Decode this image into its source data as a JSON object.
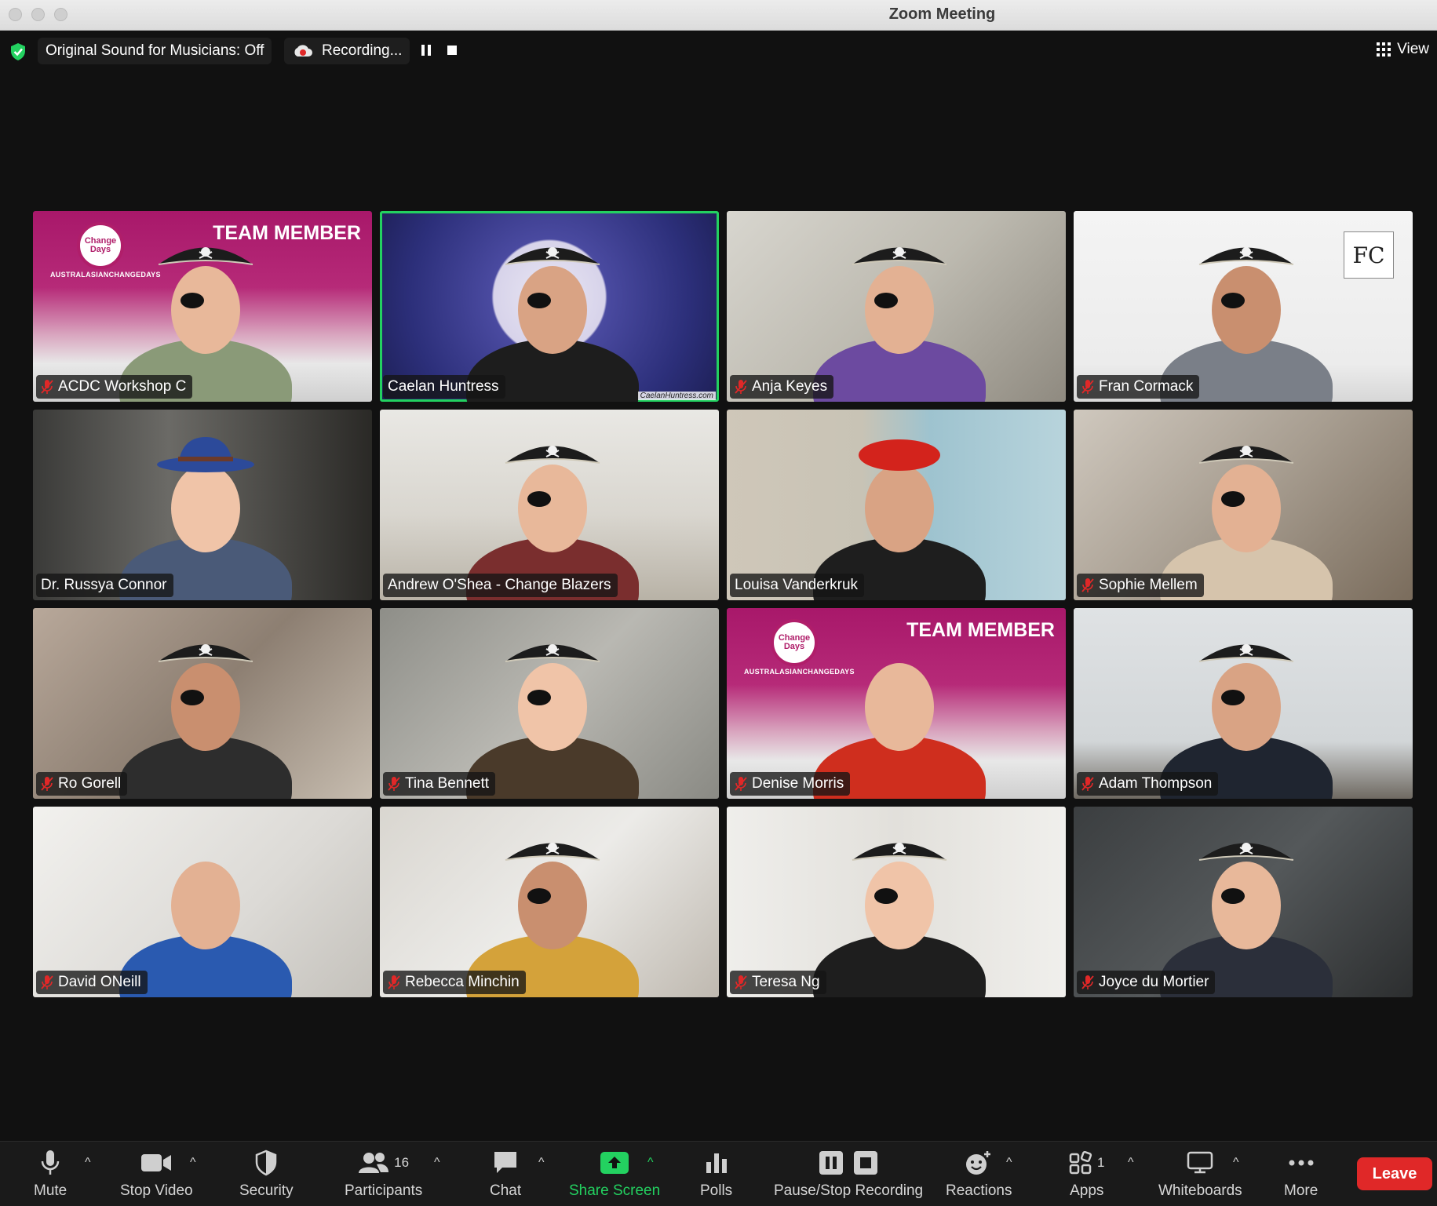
{
  "window": {
    "title": "Zoom Meeting"
  },
  "topbar": {
    "original_sound": "Original Sound for Musicians: Off",
    "recording": "Recording...",
    "view": "View"
  },
  "participants": [
    {
      "name": "ACDC Workshop C",
      "muted": true,
      "bg": "banner",
      "hat": "pirate"
    },
    {
      "name": "Caelan Huntress",
      "muted": false,
      "bg": "moon",
      "hat": "pirate",
      "active": true,
      "watermark": "CaelanHuntress.com"
    },
    {
      "name": "Anja Keyes",
      "muted": true,
      "bg": "room-light",
      "hat": "pirate"
    },
    {
      "name": "Fran Cormack",
      "muted": true,
      "bg": "white",
      "hat": "pirate",
      "logo": "FC"
    },
    {
      "name": "Dr. Russya Connor",
      "muted": false,
      "bg": "dark-room",
      "hat": "fedora"
    },
    {
      "name": "Andrew O'Shea - Change Blazers",
      "muted": false,
      "bg": "living-room",
      "hat": "pirate"
    },
    {
      "name": "Louisa Vanderkruk",
      "muted": false,
      "bg": "art-wall",
      "hat": "beret"
    },
    {
      "name": "Sophie Mellem",
      "muted": true,
      "bg": "home",
      "hat": "pirate"
    },
    {
      "name": "Ro Gorell",
      "muted": true,
      "bg": "blur-warm",
      "hat": "pirate"
    },
    {
      "name": "Tina Bennett",
      "muted": true,
      "bg": "blur-grey",
      "hat": "pirate"
    },
    {
      "name": "Denise Morris",
      "muted": true,
      "bg": "banner",
      "hat": "none"
    },
    {
      "name": "Adam Thompson",
      "muted": true,
      "bg": "whiteboard",
      "hat": "pirate"
    },
    {
      "name": "David ONeill",
      "muted": true,
      "bg": "white-room",
      "hat": "none"
    },
    {
      "name": "Rebecca Minchin",
      "muted": true,
      "bg": "blur-light",
      "hat": "pirate"
    },
    {
      "name": "Teresa Ng",
      "muted": true,
      "bg": "shelves",
      "hat": "pirate"
    },
    {
      "name": "Joyce du Mortier",
      "muted": true,
      "bg": "blur-dark",
      "hat": "pirate"
    }
  ],
  "banner": {
    "text": "TEAM MEMBER",
    "logo_text": "Change Days",
    "subtext": "AUSTRALASIANCHANGEDAYS"
  },
  "toolbar": {
    "mute": "Mute",
    "stop_video": "Stop Video",
    "security": "Security",
    "participants": "Participants",
    "participants_count": "16",
    "chat": "Chat",
    "share_screen": "Share Screen",
    "polls": "Polls",
    "pause_stop_recording": "Pause/Stop Recording",
    "reactions": "Reactions",
    "apps": "Apps",
    "apps_count": "1",
    "whiteboards": "Whiteboards",
    "more": "More",
    "leave": "Leave"
  },
  "colors": {
    "accent_green": "#23d160",
    "leave_red": "#e02828",
    "banner_magenta": "#a8186a"
  }
}
